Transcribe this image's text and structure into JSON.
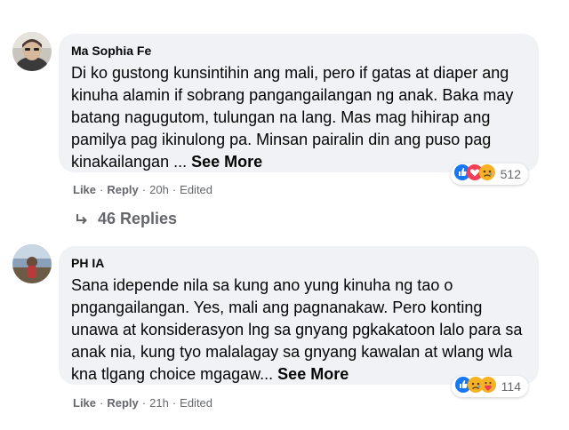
{
  "comments": [
    {
      "author": "Ma Sophia Fe",
      "text": "Di ko gustong kunsintihin ang mali, pero if gatas at diaper ang kinuha alamin if sobrang pangangailangan ng anak. Baka may batang nagugutom, tulungan na lang. Mas mag hihirap ang pamilya pag ikinulong pa. Minsan pairalin din ang puso pag kinakailangan ...",
      "see_more": "See More",
      "reaction_count": "512",
      "reactions": [
        "like-icon",
        "heart-icon",
        "sad-icon"
      ],
      "like_label": "Like",
      "reply_label": "Reply",
      "time": "20h",
      "edited": "Edited",
      "replies_label": "46 Replies"
    },
    {
      "author": "PH IA",
      "text": "Sana idepende nila sa kung ano yung kinuha ng tao o pngangailangan. Yes, mali ang pagnanakaw. Pero konting unawa at konsiderasyon lng sa gnyang pgkakatoon lalo para sa anak nia, kung tyo malalagay sa gnyang kawalan at wlang wla kna tlgang choice mgagaw...",
      "see_more": "See More",
      "reaction_count": "114",
      "reactions": [
        "like-icon",
        "sad-icon",
        "care-icon"
      ],
      "like_label": "Like",
      "reply_label": "Reply",
      "time": "21h",
      "edited": "Edited"
    }
  ],
  "colors": {
    "bubble": "#f0f2f5",
    "secondary_text": "#65676b",
    "like_blue": "#1877f2",
    "heart_red": "#f33e58",
    "sad_yellow": "#f7b125"
  }
}
